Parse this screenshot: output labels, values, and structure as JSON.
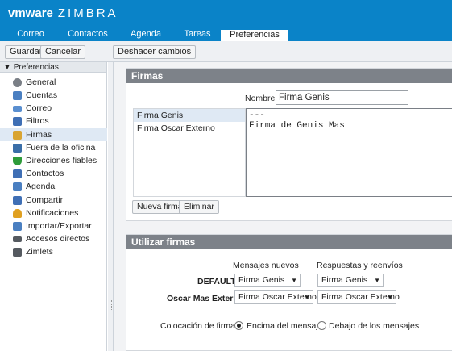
{
  "app": {
    "logo_vmware": "vmware",
    "logo_zimbra": "ZIMBRA"
  },
  "tabs": [
    {
      "label": "Correo"
    },
    {
      "label": "Contactos"
    },
    {
      "label": "Agenda"
    },
    {
      "label": "Tareas"
    },
    {
      "label": "Preferencias",
      "selected": true
    }
  ],
  "toolbar": {
    "save_label": "Guardar",
    "cancel_label": "Cancelar",
    "undo_label": "Deshacer cambios"
  },
  "sidebar": {
    "header": "Preferencias",
    "items": [
      {
        "label": "General",
        "icon": "gear-icon",
        "color": "#7a7f86"
      },
      {
        "label": "Cuentas",
        "icon": "user-icon",
        "color": "#4a7fc1"
      },
      {
        "label": "Correo",
        "icon": "mail-icon",
        "color": "#5a8fd0"
      },
      {
        "label": "Filtros",
        "icon": "filter-icon",
        "color": "#3f6fb5"
      },
      {
        "label": "Firmas",
        "icon": "signature-icon",
        "color": "#d9a431",
        "selected": true
      },
      {
        "label": "Fuera de la oficina",
        "icon": "out-of-office-icon",
        "color": "#3a6ea8"
      },
      {
        "label": "Direcciones fiables",
        "icon": "shield-icon",
        "color": "#2e9b3a"
      },
      {
        "label": "Contactos",
        "icon": "contacts-icon",
        "color": "#3f6fb5"
      },
      {
        "label": "Agenda",
        "icon": "calendar-icon",
        "color": "#4a7fc1"
      },
      {
        "label": "Compartir",
        "icon": "share-icon",
        "color": "#3f6fb5"
      },
      {
        "label": "Notificaciones",
        "icon": "bell-icon",
        "color": "#e0a020"
      },
      {
        "label": "Importar/Exportar",
        "icon": "import-export-icon",
        "color": "#4a7fc1"
      },
      {
        "label": "Accesos directos",
        "icon": "keyboard-icon",
        "color": "#555a60"
      },
      {
        "label": "Zimlets",
        "icon": "zimlet-icon",
        "color": "#555a60"
      }
    ]
  },
  "firmas": {
    "title": "Firmas",
    "name_label": "Nombre:",
    "name_value": "Firma Genis",
    "signatures": [
      {
        "label": "Firma Genis",
        "selected": true
      },
      {
        "label": "Firma Oscar Externo"
      }
    ],
    "editor_text": "---\nFirma de Genis Mas",
    "new_button": "Nueva firma",
    "delete_button": "Eliminar"
  },
  "utilizar": {
    "title": "Utilizar firmas",
    "col_new": "Mensajes nuevos",
    "col_reply": "Respuestas y reenvíos",
    "rows": [
      {
        "label": "DEFAULT:",
        "new": "Firma Genis",
        "reply": "Firma Genis"
      },
      {
        "label": "Oscar Mas Externo:",
        "new": "Firma Oscar Externo",
        "reply": "Firma Oscar Externo"
      }
    ],
    "placement_label": "Colocación de firmas:",
    "placement_options": [
      {
        "label": "Encima del mensaje",
        "checked": true
      },
      {
        "label": "Debajo de los mensajes",
        "checked": false
      }
    ]
  }
}
